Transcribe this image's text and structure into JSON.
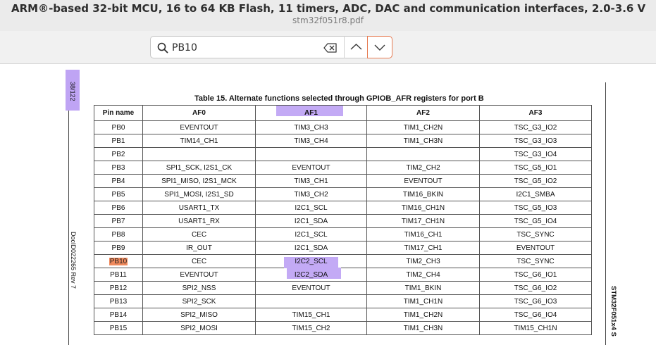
{
  "window": {
    "title": "ARM®-based 32-bit MCU, 16 to 64 KB Flash, 11 timers, ADC, DAC and communication interfaces, 2.0-3.6 V",
    "filename": "stm32f051r8.pdf"
  },
  "search": {
    "query": "PB10",
    "icons": [
      "search-icon",
      "clear-icon",
      "chevron-up-icon",
      "chevron-down-icon"
    ]
  },
  "page": {
    "page_number": "38/122",
    "doc_id": "DocID022265 Rev 7",
    "part_name": "STM32F051x4 S",
    "table_caption": "Table 15. Alternate functions selected through GPIOB_AFR registers for port B",
    "columns": [
      "Pin name",
      "AF0",
      "AF1",
      "AF2",
      "AF3"
    ],
    "rows": [
      [
        "PB0",
        "EVENTOUT",
        "TIM3_CH3",
        "TIM1_CH2N",
        "TSC_G3_IO2"
      ],
      [
        "PB1",
        "TIM14_CH1",
        "TIM3_CH4",
        "TIM1_CH3N",
        "TSC_G3_IO3"
      ],
      [
        "PB2",
        "",
        "",
        "",
        "TSC_G3_IO4"
      ],
      [
        "PB3",
        "SPI1_SCK, I2S1_CK",
        "EVENTOUT",
        "TIM2_CH2",
        "TSC_G5_IO1"
      ],
      [
        "PB4",
        "SPI1_MISO, I2S1_MCK",
        "TIM3_CH1",
        "EVENTOUT",
        "TSC_G5_IO2"
      ],
      [
        "PB5",
        "SPI1_MOSI, I2S1_SD",
        "TIM3_CH2",
        "TIM16_BKIN",
        "I2C1_SMBA"
      ],
      [
        "PB6",
        "USART1_TX",
        "I2C1_SCL",
        "TIM16_CH1N",
        "TSC_G5_IO3"
      ],
      [
        "PB7",
        "USART1_RX",
        "I2C1_SDA",
        "TIM17_CH1N",
        "TSC_G5_IO4"
      ],
      [
        "PB8",
        "CEC",
        "I2C1_SCL",
        "TIM16_CH1",
        "TSC_SYNC"
      ],
      [
        "PB9",
        "IR_OUT",
        "I2C1_SDA",
        "TIM17_CH1",
        "EVENTOUT"
      ],
      [
        "PB10",
        "CEC",
        "I2C2_SCL",
        "TIM2_CH3",
        "TSC_SYNC"
      ],
      [
        "PB11",
        "EVENTOUT",
        "I2C2_SDA",
        "TIM2_CH4",
        "TSC_G6_IO1"
      ],
      [
        "PB12",
        "SPI2_NSS",
        "EVENTOUT",
        "TIM1_BKIN",
        "TSC_G6_IO2"
      ],
      [
        "PB13",
        "SPI2_SCK",
        "",
        "TIM1_CH1N",
        "TSC_G6_IO3"
      ],
      [
        "PB14",
        "SPI2_MISO",
        "TIM15_CH1",
        "TIM1_CH2N",
        "TSC_G6_IO4"
      ],
      [
        "PB15",
        "SPI2_MOSI",
        "TIM15_CH2",
        "TIM1_CH3N",
        "TIM15_CH1N"
      ]
    ]
  },
  "colors": {
    "highlight_annotation": "#c3aaf5",
    "search_match": "#f08a5d",
    "active_button_border": "#e77b52"
  }
}
